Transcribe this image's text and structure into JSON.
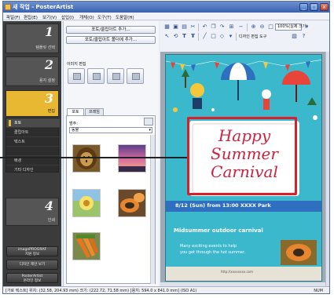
{
  "window": {
    "title": "새 작업 - PosterArtist",
    "min_glyph": "_",
    "max_glyph": "□",
    "close_glyph": "x"
  },
  "menu": [
    "파일(F)",
    "편집(E)",
    "보기(V)",
    "삽입(I)",
    "개체(O)",
    "도구(T)",
    "도움말(H)"
  ],
  "steps": [
    {
      "num": "1",
      "label": "템플릿 선택"
    },
    {
      "num": "2",
      "label": "용지 설정"
    },
    {
      "num": "3",
      "label": "편집"
    },
    {
      "num": "4",
      "label": "인쇄"
    }
  ],
  "substeps": [
    "포토",
    "클립아트",
    "텍스트",
    "",
    "배경",
    "기타 디자인"
  ],
  "left_buttons": [
    {
      "line1": "imagePROGRAF",
      "line2": "지원 정보"
    },
    {
      "line1": "디자인 제안 보기",
      "line2": ""
    },
    {
      "line1": "PosterArtist",
      "line2": "온라인 정보"
    }
  ],
  "panel": {
    "add_button": "포토/클립아트 추가...",
    "add_folder_button": "포토/클립아트 폴더에 추가...",
    "image_edit_label": "이미지 편집",
    "tabs": [
      "포토",
      "프레임"
    ],
    "category_label": "범주:",
    "category_value": "동물"
  },
  "toolbar": {
    "zoom_value": "100%(실제 크기)",
    "text_fit_label": "디자인 편집 도구"
  },
  "poster": {
    "title_line1": "Happy",
    "title_line2": "Summer",
    "title_line3": "Carnival",
    "date_line": "8/12 (Sun) from 13:00  XXXX Park",
    "subtitle": "Midsummer outdoor carnival",
    "body_line1": "Many exciting events to help",
    "body_line2": "you get through the hot summer.",
    "url": "http://xxxxxxxx.com"
  },
  "status": {
    "left": "[가로 텍스트] 위치: (32.58, 204.93 mm) 크기: (222.72, 71.58 mm) [용지: 594.0 x 841.0 mm] (ISO A1)",
    "right": "NUM"
  },
  "colors": {
    "step_active": "#e8b832",
    "poster_bg": "#3bb8cc",
    "title_text": "#d0203e",
    "callout": "#d91f2a"
  }
}
